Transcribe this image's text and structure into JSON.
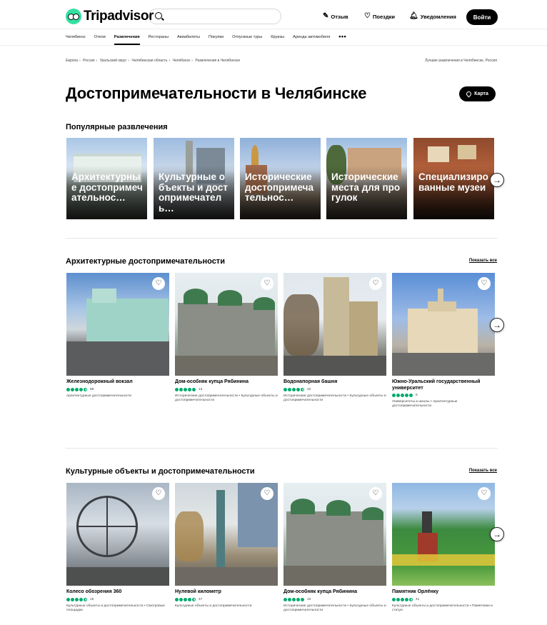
{
  "header": {
    "logo_text": "Tripadvisor",
    "search_placeholder": "",
    "review_label": "Отзыв",
    "trips_label": "Поездки",
    "alerts_label": "Уведомления",
    "login_label": "Войти"
  },
  "nav": {
    "items": [
      "Челябинск",
      "Отели",
      "Развлечения",
      "Рестораны",
      "Авиабилеты",
      "Покупки",
      "Отпускные туры",
      "Круизы",
      "Аренда автомобиля"
    ],
    "active_index": 2,
    "more": "•••"
  },
  "breadcrumb": [
    "Европа",
    "Россия",
    "Уральский округ",
    "Челябинская область",
    "Челябинск",
    "Развлечения в Челябинске"
  ],
  "best_text": "Лучшие развлечения в Челябинске, Россия",
  "page_title": "Достопримечательности в Челябинске",
  "map_button": "Карта",
  "popular": {
    "heading": "Популярные развлечения",
    "cards": [
      {
        "label": "Архитектурные достопримечательнос…"
      },
      {
        "label": "Культурные объекты и достопримечатель…"
      },
      {
        "label": "Исторические достопримечательнос…"
      },
      {
        "label": "Исторические места для прогулок"
      },
      {
        "label": "Специализированные музеи"
      }
    ]
  },
  "architecture": {
    "heading": "Архитектурные достопримечательности",
    "show_all": "Показать все",
    "cards": [
      {
        "name": "Железнодорожный вокзал",
        "rating": 4.5,
        "reviews": "88",
        "category": "Архитектурные достопримечательности"
      },
      {
        "name": "Дом-особняк купца Рябинина",
        "rating": 5,
        "reviews": "13",
        "category": "Исторические достопримечательности • Культурные объекты и достопримечательности"
      },
      {
        "name": "Водонапорная башня",
        "rating": 4.5,
        "reviews": "22",
        "category": "Исторические достопримечательности • Культурные объекты и достопримечательности"
      },
      {
        "name": "Южно-Уральский государственный университет",
        "rating": 5,
        "reviews": "6",
        "category": "Университеты и школы • Архитектурные достопримечательности"
      }
    ]
  },
  "cultural": {
    "heading": "Культурные объекты и достопримечательности",
    "show_all": "Показать все",
    "cards": [
      {
        "name": "Колесо обозрения 360",
        "rating": 4.5,
        "reviews": "15",
        "category": "Культурные объекты и достопримечательности • Смотровые площадки"
      },
      {
        "name": "Нулевой километр",
        "rating": 4.5,
        "reviews": "47",
        "category": "Культурные объекты и достопримечательности"
      },
      {
        "name": "Дом-особняк купца Рябинина",
        "rating": 5,
        "reviews": "10",
        "category": "Исторические достопримечательности • Культурные объекты и достопримечательности"
      },
      {
        "name": "Памятник Орлёнку",
        "rating": 4.5,
        "reviews": "41",
        "category": "Культурные объекты и достопримечательности • Памятники и статуи"
      }
    ]
  },
  "colors": {
    "brand_green": "#34e0a1",
    "rating_green": "#00aa6c",
    "black": "#000000"
  },
  "icons": {
    "heart": "heart-icon",
    "arrow": "arrow-right-icon",
    "search": "search-icon",
    "pin": "map-pin-icon"
  }
}
